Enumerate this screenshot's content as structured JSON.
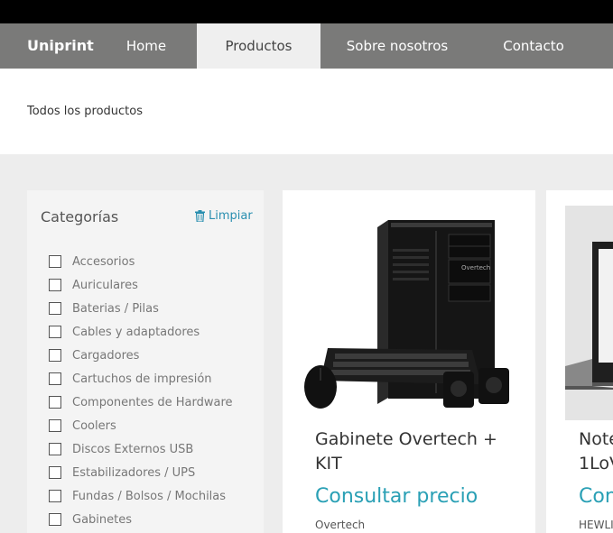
{
  "nav": {
    "brand": "Uniprint",
    "links": [
      "Home",
      "Productos",
      "Sobre nosotros",
      "Contacto"
    ]
  },
  "breadcrumb": "Todos los productos",
  "sidebar": {
    "title": "Categorías",
    "clear_label": "Limpiar",
    "categories": [
      "Accesorios",
      "Auriculares",
      "Baterias / Pilas",
      "Cables y adaptadores",
      "Cargadores",
      "Cartuchos de impresión",
      "Componentes de Hardware",
      "Coolers",
      "Discos Externos USB",
      "Estabilizadores / UPS",
      "Fundas / Bolsos / Mochilas",
      "Gabinetes"
    ]
  },
  "products": [
    {
      "name_line1": "Gabinete Overtech +",
      "name_line2": "KIT",
      "price_label": "Consultar precio",
      "brand": "Overtech"
    },
    {
      "name_line1": "Note",
      "name_line2": "1LoV",
      "price_label": "Con",
      "brand": "HEWLI"
    }
  ],
  "colors": {
    "accent": "#2aa0b5",
    "nav_bg": "#7a7a79",
    "active_tab_bg": "#efefef"
  }
}
